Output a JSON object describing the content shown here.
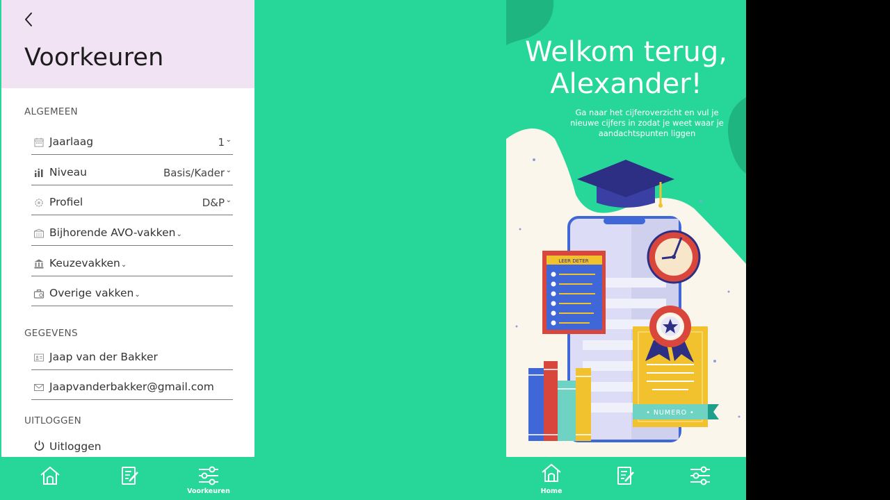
{
  "preferences": {
    "title": "Voorkeuren",
    "sections": {
      "general": "ALGEMEEN",
      "details": "GEGEVENS",
      "logout": "UITLOGGEN"
    },
    "fields": {
      "year": {
        "label": "Jaarlaag",
        "value": "1"
      },
      "level": {
        "label": "Niveau",
        "value": "Basis/Kader"
      },
      "profile": {
        "label": "Profiel",
        "value": "D&P"
      },
      "avo": {
        "label": "Bijhorende AVO-vakken"
      },
      "electives": {
        "label": "Keuzevakken"
      },
      "other": {
        "label": "Overige vakken"
      },
      "name": {
        "label": "Jaap van der Bakker"
      },
      "email": {
        "label": "Jaapvanderbakker@gmail.com"
      }
    },
    "logout_label": "Uitloggen",
    "caret": "⌄"
  },
  "left_nav": {
    "home": "",
    "grades": "",
    "preferences": "Voorkeuren"
  },
  "welcome": {
    "title_line1": "Welkom terug,",
    "title_line2": "Alexander!",
    "subtitle": "Ga naar het cijferoverzicht en vul je nieuwe cijfers in zodat je weet waar je aandachtspunten liggen",
    "clipboard_label": "LEER DETER",
    "certificate_label": "• NUMERO •"
  },
  "right_nav": {
    "home": "Home",
    "grades": "",
    "preferences": ""
  },
  "colors": {
    "brand_green": "#27d79a",
    "header_lilac": "#f1e2f4",
    "navy": "#2d2f84",
    "red": "#d9473c",
    "yellow": "#f2c12e"
  }
}
